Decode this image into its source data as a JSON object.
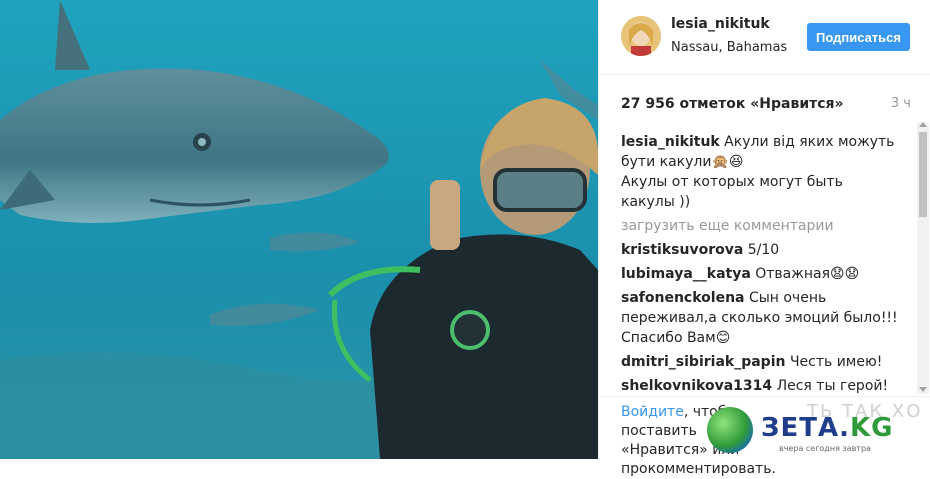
{
  "post": {
    "username": "lesia_nikituk",
    "location": "Nassau, Bahamas",
    "follow_label": "Подписаться",
    "likes": "27 956 отметок «Нравится»",
    "time_ago": "3 ч"
  },
  "caption": {
    "user": "lesia_nikituk",
    "text_line1": "Акули від яких можуть бути какули🙊😆",
    "text_line2": "Акулы от которых могут быть какулы ))"
  },
  "load_more": "загрузить еще комментарии",
  "comments": [
    {
      "user": "kristiksuvorova",
      "text": "5/10"
    },
    {
      "user": "lubimaya__katya",
      "text": "Отважная😧😧"
    },
    {
      "user": "safonenckolena",
      "text": "Сын очень переживал,а сколько эмоций было!!! Спасибо Вам😊"
    },
    {
      "user": "dmitri_sibiriak_papin",
      "text": "Честь имею!"
    },
    {
      "user": "shelkovnikova1314",
      "text": "Леся ты герой!💪💪💪"
    }
  ],
  "footer": {
    "login_link": "Войдите",
    "text_part1": ", чтобы поставить",
    "text_part2": "«Нравится» или",
    "text_part3": "прокомментировать."
  },
  "watermark": {
    "brand": "ЗЕТА.",
    "brand_tld": "KG",
    "tagline": "вчера сегодня завтра",
    "ghost_text": "ТЬ ТАК ХО"
  },
  "colors": {
    "accent": "#3897f0",
    "water": "#1e98b3"
  }
}
